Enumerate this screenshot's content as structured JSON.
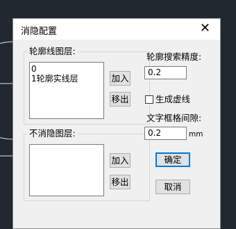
{
  "dialog": {
    "title": "消隐配置",
    "close_glyph": "✕"
  },
  "contour_layers": {
    "label": "轮廓线图层:",
    "items": [
      "0",
      "1轮廓实线层"
    ],
    "add_label": "加入",
    "remove_label": "移出"
  },
  "unhidden_layers": {
    "label": "不消隐图层:",
    "items": [],
    "add_label": "加入",
    "remove_label": "移出"
  },
  "search_precision": {
    "label": "轮廓搜索精度:",
    "value": "0.2"
  },
  "generate_dashed": {
    "label": "生成虚线",
    "checked": false
  },
  "text_frame_gap": {
    "label": "文字框格间隙:",
    "value": "0.2",
    "unit": "mm"
  },
  "actions": {
    "ok_label": "确定",
    "cancel_label": "取消"
  },
  "colors": {
    "background": "#212830",
    "dialog": "#f0f0f0",
    "focus_border": "#0078d7"
  }
}
